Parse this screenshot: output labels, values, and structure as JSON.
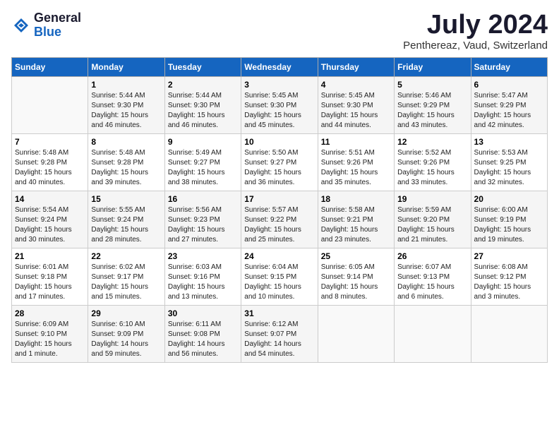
{
  "header": {
    "logo_general": "General",
    "logo_blue": "Blue",
    "month": "July 2024",
    "location": "Penthereaz, Vaud, Switzerland"
  },
  "days_of_week": [
    "Sunday",
    "Monday",
    "Tuesday",
    "Wednesday",
    "Thursday",
    "Friday",
    "Saturday"
  ],
  "weeks": [
    [
      {
        "day": "",
        "info": ""
      },
      {
        "day": "1",
        "info": "Sunrise: 5:44 AM\nSunset: 9:30 PM\nDaylight: 15 hours\nand 46 minutes."
      },
      {
        "day": "2",
        "info": "Sunrise: 5:44 AM\nSunset: 9:30 PM\nDaylight: 15 hours\nand 46 minutes."
      },
      {
        "day": "3",
        "info": "Sunrise: 5:45 AM\nSunset: 9:30 PM\nDaylight: 15 hours\nand 45 minutes."
      },
      {
        "day": "4",
        "info": "Sunrise: 5:45 AM\nSunset: 9:30 PM\nDaylight: 15 hours\nand 44 minutes."
      },
      {
        "day": "5",
        "info": "Sunrise: 5:46 AM\nSunset: 9:29 PM\nDaylight: 15 hours\nand 43 minutes."
      },
      {
        "day": "6",
        "info": "Sunrise: 5:47 AM\nSunset: 9:29 PM\nDaylight: 15 hours\nand 42 minutes."
      }
    ],
    [
      {
        "day": "7",
        "info": "Sunrise: 5:48 AM\nSunset: 9:28 PM\nDaylight: 15 hours\nand 40 minutes."
      },
      {
        "day": "8",
        "info": "Sunrise: 5:48 AM\nSunset: 9:28 PM\nDaylight: 15 hours\nand 39 minutes."
      },
      {
        "day": "9",
        "info": "Sunrise: 5:49 AM\nSunset: 9:27 PM\nDaylight: 15 hours\nand 38 minutes."
      },
      {
        "day": "10",
        "info": "Sunrise: 5:50 AM\nSunset: 9:27 PM\nDaylight: 15 hours\nand 36 minutes."
      },
      {
        "day": "11",
        "info": "Sunrise: 5:51 AM\nSunset: 9:26 PM\nDaylight: 15 hours\nand 35 minutes."
      },
      {
        "day": "12",
        "info": "Sunrise: 5:52 AM\nSunset: 9:26 PM\nDaylight: 15 hours\nand 33 minutes."
      },
      {
        "day": "13",
        "info": "Sunrise: 5:53 AM\nSunset: 9:25 PM\nDaylight: 15 hours\nand 32 minutes."
      }
    ],
    [
      {
        "day": "14",
        "info": "Sunrise: 5:54 AM\nSunset: 9:24 PM\nDaylight: 15 hours\nand 30 minutes."
      },
      {
        "day": "15",
        "info": "Sunrise: 5:55 AM\nSunset: 9:24 PM\nDaylight: 15 hours\nand 28 minutes."
      },
      {
        "day": "16",
        "info": "Sunrise: 5:56 AM\nSunset: 9:23 PM\nDaylight: 15 hours\nand 27 minutes."
      },
      {
        "day": "17",
        "info": "Sunrise: 5:57 AM\nSunset: 9:22 PM\nDaylight: 15 hours\nand 25 minutes."
      },
      {
        "day": "18",
        "info": "Sunrise: 5:58 AM\nSunset: 9:21 PM\nDaylight: 15 hours\nand 23 minutes."
      },
      {
        "day": "19",
        "info": "Sunrise: 5:59 AM\nSunset: 9:20 PM\nDaylight: 15 hours\nand 21 minutes."
      },
      {
        "day": "20",
        "info": "Sunrise: 6:00 AM\nSunset: 9:19 PM\nDaylight: 15 hours\nand 19 minutes."
      }
    ],
    [
      {
        "day": "21",
        "info": "Sunrise: 6:01 AM\nSunset: 9:18 PM\nDaylight: 15 hours\nand 17 minutes."
      },
      {
        "day": "22",
        "info": "Sunrise: 6:02 AM\nSunset: 9:17 PM\nDaylight: 15 hours\nand 15 minutes."
      },
      {
        "day": "23",
        "info": "Sunrise: 6:03 AM\nSunset: 9:16 PM\nDaylight: 15 hours\nand 13 minutes."
      },
      {
        "day": "24",
        "info": "Sunrise: 6:04 AM\nSunset: 9:15 PM\nDaylight: 15 hours\nand 10 minutes."
      },
      {
        "day": "25",
        "info": "Sunrise: 6:05 AM\nSunset: 9:14 PM\nDaylight: 15 hours\nand 8 minutes."
      },
      {
        "day": "26",
        "info": "Sunrise: 6:07 AM\nSunset: 9:13 PM\nDaylight: 15 hours\nand 6 minutes."
      },
      {
        "day": "27",
        "info": "Sunrise: 6:08 AM\nSunset: 9:12 PM\nDaylight: 15 hours\nand 3 minutes."
      }
    ],
    [
      {
        "day": "28",
        "info": "Sunrise: 6:09 AM\nSunset: 9:10 PM\nDaylight: 15 hours\nand 1 minute."
      },
      {
        "day": "29",
        "info": "Sunrise: 6:10 AM\nSunset: 9:09 PM\nDaylight: 14 hours\nand 59 minutes."
      },
      {
        "day": "30",
        "info": "Sunrise: 6:11 AM\nSunset: 9:08 PM\nDaylight: 14 hours\nand 56 minutes."
      },
      {
        "day": "31",
        "info": "Sunrise: 6:12 AM\nSunset: 9:07 PM\nDaylight: 14 hours\nand 54 minutes."
      },
      {
        "day": "",
        "info": ""
      },
      {
        "day": "",
        "info": ""
      },
      {
        "day": "",
        "info": ""
      }
    ]
  ]
}
